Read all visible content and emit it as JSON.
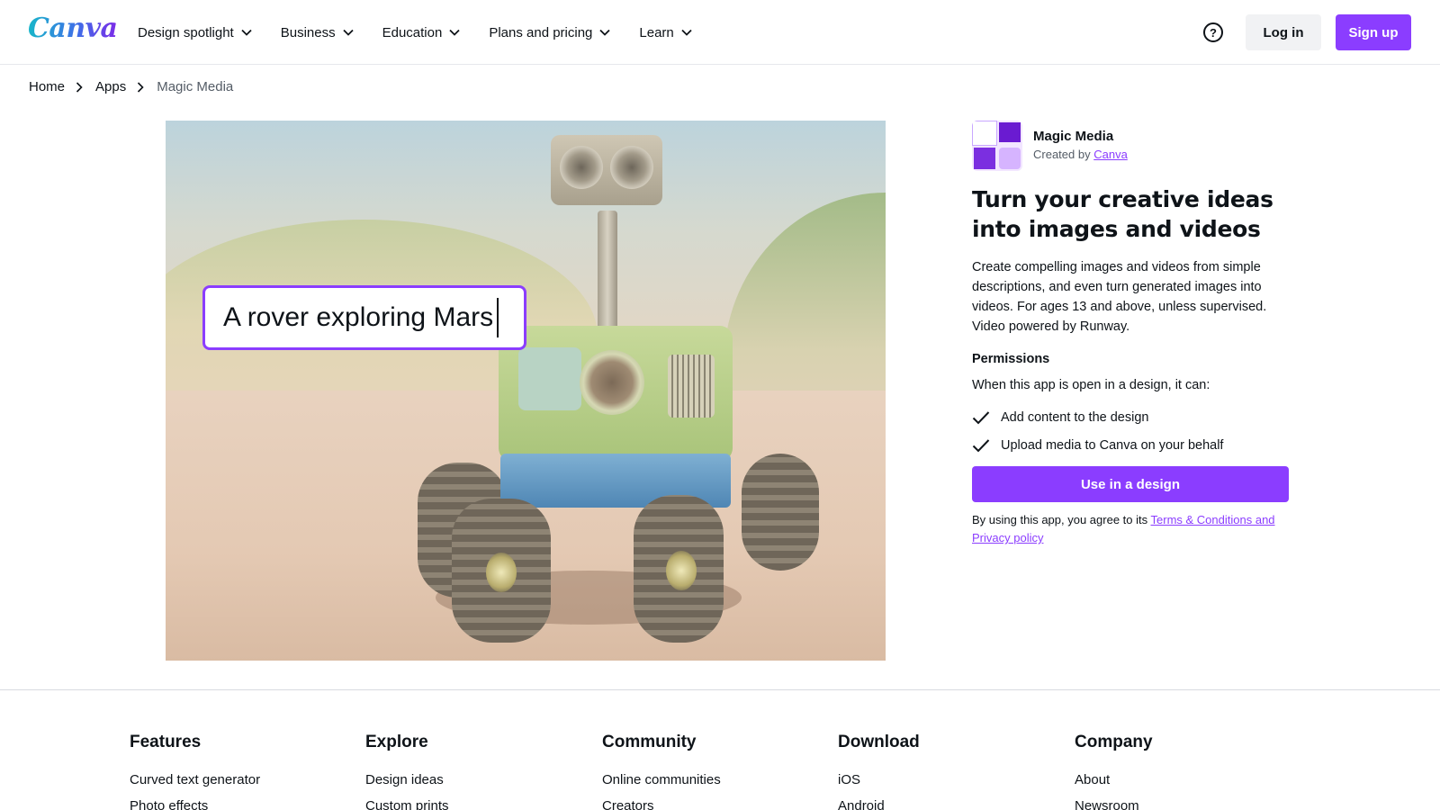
{
  "header": {
    "logo": "Canva",
    "nav": [
      {
        "label": "Design spotlight"
      },
      {
        "label": "Business"
      },
      {
        "label": "Education"
      },
      {
        "label": "Plans and pricing"
      },
      {
        "label": "Learn"
      }
    ],
    "help_glyph": "?",
    "login_label": "Log in",
    "signup_label": "Sign up"
  },
  "breadcrumb": {
    "items": [
      "Home",
      "Apps"
    ],
    "current": "Magic Media"
  },
  "hero": {
    "prompt_text": "A rover exploring Mars"
  },
  "app": {
    "name": "Magic Media",
    "created_by_prefix": "Created by",
    "creator": "Canva",
    "headline": "Turn your creative ideas into images and videos",
    "description": "Create compelling images and videos from simple descriptions, and even turn generated images into videos. For ages 13 and above, unless supervised. Video powered by Runway.",
    "permissions_title": "Permissions",
    "permissions_intro": "When this app is open in a design, it can:",
    "permissions": [
      "Add content to the design",
      "Upload media to Canva on your behalf"
    ],
    "use_button": "Use in a design",
    "terms_prefix": "By using this app, you agree to its",
    "terms_link": "Terms & Conditions and Privacy policy"
  },
  "footer": {
    "columns": [
      {
        "title": "Features",
        "links": [
          "Curved text generator",
          "Photo effects"
        ]
      },
      {
        "title": "Explore",
        "links": [
          "Design ideas",
          "Custom prints"
        ]
      },
      {
        "title": "Community",
        "links": [
          "Online communities",
          "Creators"
        ]
      },
      {
        "title": "Download",
        "links": [
          "iOS",
          "Android"
        ]
      },
      {
        "title": "Company",
        "links": [
          "About",
          "Newsroom"
        ]
      }
    ]
  },
  "colors": {
    "accent": "#8b3dff",
    "text": "#0e1318",
    "muted": "#545c66"
  },
  "icons": [
    "help-icon",
    "chevron-down-icon",
    "chevron-right-icon",
    "check-icon",
    "magic-media-app-icon"
  ]
}
